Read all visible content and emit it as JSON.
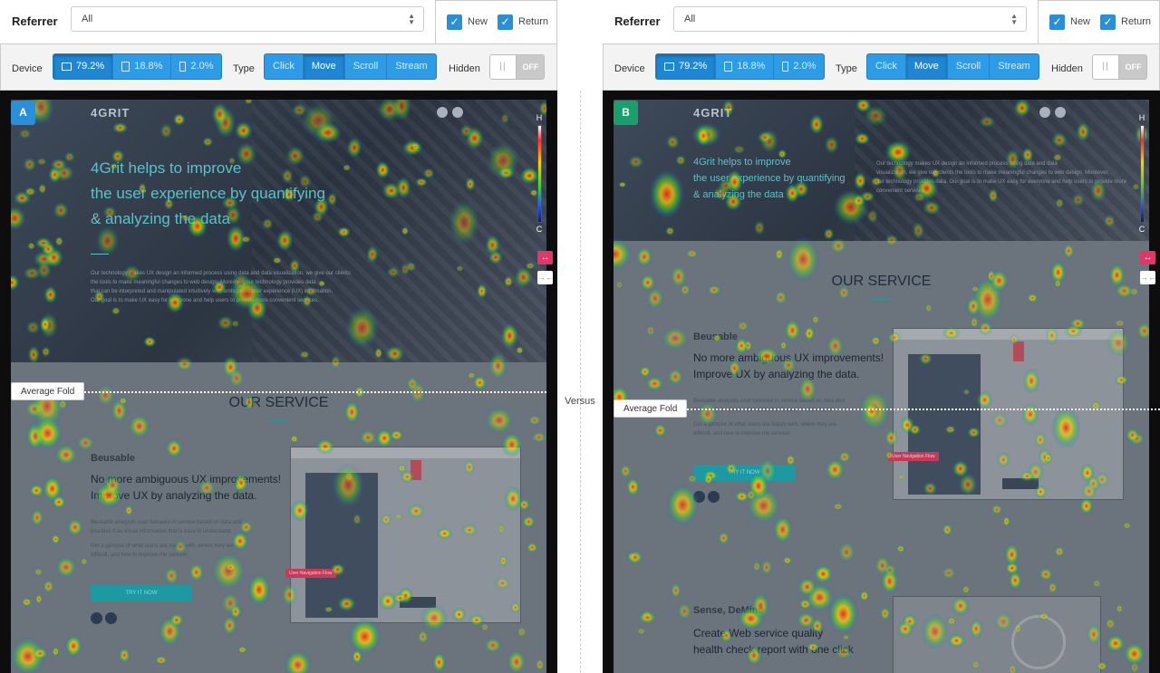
{
  "versus_label": "Versus",
  "panes": [
    {
      "id": "A",
      "referrer": {
        "label": "Referrer",
        "selected": "All"
      },
      "visitor": {
        "new_label": "New",
        "new_checked": true,
        "return_label": "Return",
        "return_checked": true
      },
      "device": {
        "label": "Device",
        "options": [
          {
            "icon": "desktop-icon",
            "value": "79.2%",
            "active": true
          },
          {
            "icon": "tablet-icon",
            "value": "18.8%",
            "active": false
          },
          {
            "icon": "mobile-icon",
            "value": "2.0%",
            "active": false
          }
        ]
      },
      "type": {
        "label": "Type",
        "options": [
          {
            "label": "Click",
            "active": false
          },
          {
            "label": "Move",
            "active": true
          },
          {
            "label": "Scroll",
            "active": false
          },
          {
            "label": "Stream",
            "active": false
          }
        ]
      },
      "hidden": {
        "label": "Hidden",
        "state": "OFF"
      },
      "legend": {
        "high": "H",
        "low": "C"
      },
      "fold_label": "Average Fold",
      "site": {
        "logo": "4GRIT",
        "hero_title": [
          "4Grit helps to improve",
          "the user experience by quantifying",
          "& analyzing the data"
        ],
        "hero_text": [
          "Our technology makes UX design an informed process using data and data visualization, we give our clients",
          "the tools to make meaningful changes to web design. Moreover, our technology provides data",
          "that can be interpreted and manipulated intuitively with ambiguous user experience (UX) information.",
          "Our goal is to make UX easy for everyone and help users to provide more convenient services."
        ],
        "service_title": "OUR SERVICE",
        "service_sub": "Beusable",
        "service_head": [
          "No more ambiguous UX improvements!",
          "Improve UX by analyzing the data."
        ],
        "service_text": [
          "Beusable analyzes user behavior in service based on data and",
          "provides it as visual information that is easy to understand.",
          "Get a glimpse of what users are happy with, where they are",
          "difficult, and how to improve the service!"
        ],
        "try_label": "TRY IT NOW",
        "mock_tag": "User Navigation Flow"
      }
    },
    {
      "id": "B",
      "referrer": {
        "label": "Referrer",
        "selected": "All"
      },
      "visitor": {
        "new_label": "New",
        "new_checked": true,
        "return_label": "Return",
        "return_checked": true
      },
      "device": {
        "label": "Device",
        "options": [
          {
            "icon": "desktop-icon",
            "value": "79.2%",
            "active": true
          },
          {
            "icon": "tablet-icon",
            "value": "18.8%",
            "active": false
          },
          {
            "icon": "mobile-icon",
            "value": "2.0%",
            "active": false
          }
        ]
      },
      "type": {
        "label": "Type",
        "options": [
          {
            "label": "Click",
            "active": false
          },
          {
            "label": "Move",
            "active": true
          },
          {
            "label": "Scroll",
            "active": false
          },
          {
            "label": "Stream",
            "active": false
          }
        ]
      },
      "hidden": {
        "label": "Hidden",
        "state": "OFF"
      },
      "legend": {
        "high": "H",
        "low": "C"
      },
      "fold_label": "Average Fold",
      "site": {
        "logo": "4GRIT",
        "hero_title": [
          "4Grit helps to improve",
          "the user experience by quantifying",
          "& analyzing the data"
        ],
        "hero_text": [
          "Our technology makes UX design an informed process using data and data",
          "visualization, we give our clients the tools to make meaningful changes to web design. Moreover,",
          "our technology provides data. Our goal is to make UX easy for everyone and help users to provide more",
          "convenient services."
        ],
        "service_title": "OUR SERVICE",
        "service_sub": "Beusable",
        "service_head": [
          "No more ambiguous UX improvements!",
          "Improve UX by analyzing the data."
        ],
        "service_text": [
          "Beusable analyzes user behavior in service based on data and",
          "provides it as visual information that is easy to understand.",
          "Get a glimpse of what users are happy with, where they are",
          "difficult, and how to improve the service!"
        ],
        "try_label": "TRY IT NOW",
        "mock_tag": "User Navigation Flow",
        "service2_sub": "Sense, DeMine",
        "service2_head": [
          "Create Web service quality",
          "health check report with one click"
        ]
      }
    }
  ]
}
